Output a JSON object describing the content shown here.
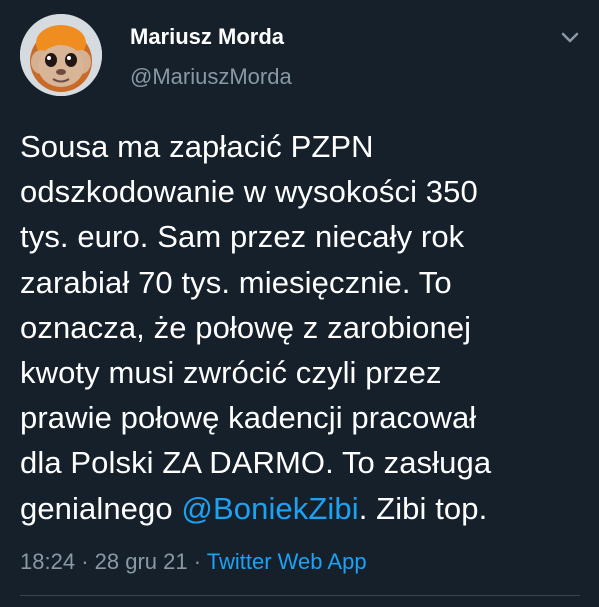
{
  "tweet": {
    "name": "Mariusz Morda",
    "handle": "@MariuszMorda",
    "body_lines": [
      "Sousa ma zapłacić PZPN",
      "odszkodowanie w wysokości 350",
      "tys. euro. Sam przez niecały rok",
      "zarabiał 70 tys. miesięcznie. To",
      "oznacza, że połowę z zarobionej",
      "kwoty musi zwrócić czyli przez",
      "prawie połowę kadencji pracował",
      "dla Polski ZA DARMO. To zasługa"
    ],
    "last_line_prefix": "genialnego ",
    "mention": "@BoniekZibi",
    "last_line_suffix": ". Zibi top.",
    "time": "18:24",
    "date": "28 gru 21",
    "source": "Twitter Web App",
    "separator": "·"
  },
  "icons": {
    "avatar": "monkey-avatar",
    "menu": "chevron-down-icon"
  },
  "colors": {
    "background": "#15202b",
    "text": "#ffffff",
    "secondary": "#8899a6",
    "link": "#1da1f2"
  }
}
